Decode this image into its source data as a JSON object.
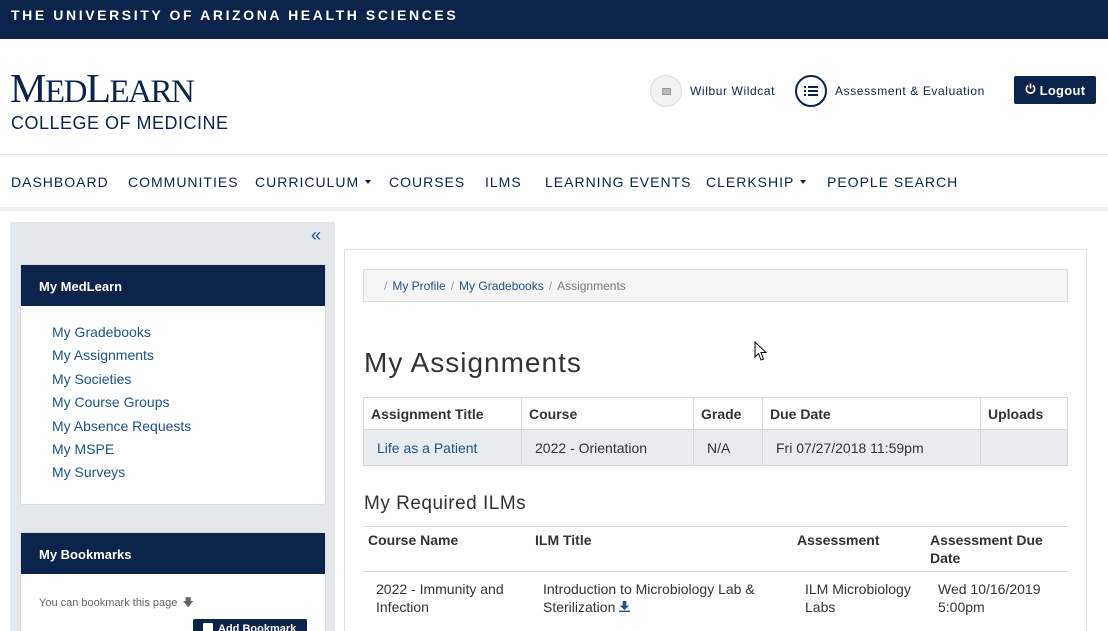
{
  "topbar": {
    "text": "THE UNIVERSITY OF ARIZONA HEALTH SCIENCES"
  },
  "logo": {
    "main_big1": "M",
    "main_small1": "ED",
    "main_big2": "L",
    "main_small2": "EARN",
    "sub": "COLLEGE OF MEDICINE"
  },
  "user": {
    "name": "Wilbur Wildcat",
    "avatar_icon": "broken-image-icon"
  },
  "assessment": {
    "label": "Assessment & Evaluation",
    "icon": "list-icon"
  },
  "logout": {
    "label": "Logout",
    "icon": "power-icon"
  },
  "nav": {
    "items": [
      {
        "label": "DASHBOARD",
        "dropdown": false
      },
      {
        "label": "COMMUNITIES",
        "dropdown": false
      },
      {
        "label": "CURRICULUM",
        "dropdown": true
      },
      {
        "label": "COURSES",
        "dropdown": false
      },
      {
        "label": "ILMS",
        "dropdown": false
      },
      {
        "label": "LEARNING EVENTS",
        "dropdown": false
      },
      {
        "label": "CLERKSHIP",
        "dropdown": true
      },
      {
        "label": "PEOPLE SEARCH",
        "dropdown": false
      }
    ]
  },
  "sidebar": {
    "collapse_glyph": "«",
    "my_medlearn": {
      "title": "My MedLearn",
      "links": [
        "My Gradebooks",
        "My Assignments",
        "My Societies",
        "My Course Groups",
        "My Absence Requests",
        "My MSPE",
        "My Surveys"
      ]
    },
    "bookmarks": {
      "title": "My Bookmarks",
      "hint": "You can bookmark this page",
      "add_label": "Add Bookmark"
    }
  },
  "breadcrumb": {
    "items": [
      "My Profile",
      "My Gradebooks"
    ],
    "current": "Assignments"
  },
  "assignments": {
    "heading": "My Assignments",
    "columns": [
      "Assignment Title",
      "Course",
      "Grade",
      "Due Date",
      "Uploads"
    ],
    "rows": [
      {
        "title": "Life as a Patient",
        "course": "2022 - Orientation",
        "grade": "N/A",
        "due": "Fri 07/27/2018 11:59pm",
        "uploads": ""
      }
    ]
  },
  "ilms": {
    "heading": "My Required ILMs",
    "columns": [
      "Course Name",
      "ILM Title",
      "Assessment",
      "Assessment Due Date"
    ],
    "rows": [
      {
        "course": "2022 - Immunity and Infection",
        "title": "Introduction to Microbiology Lab & Sterilization",
        "assessment": "ILM Microbiology Labs",
        "due": "Wed 10/16/2019 5:00pm"
      }
    ]
  },
  "colors": {
    "navy": "#0c234b",
    "link": "#1e5288",
    "sidebar_bg": "#e5e8eb",
    "row_bg": "#e9ecef"
  }
}
